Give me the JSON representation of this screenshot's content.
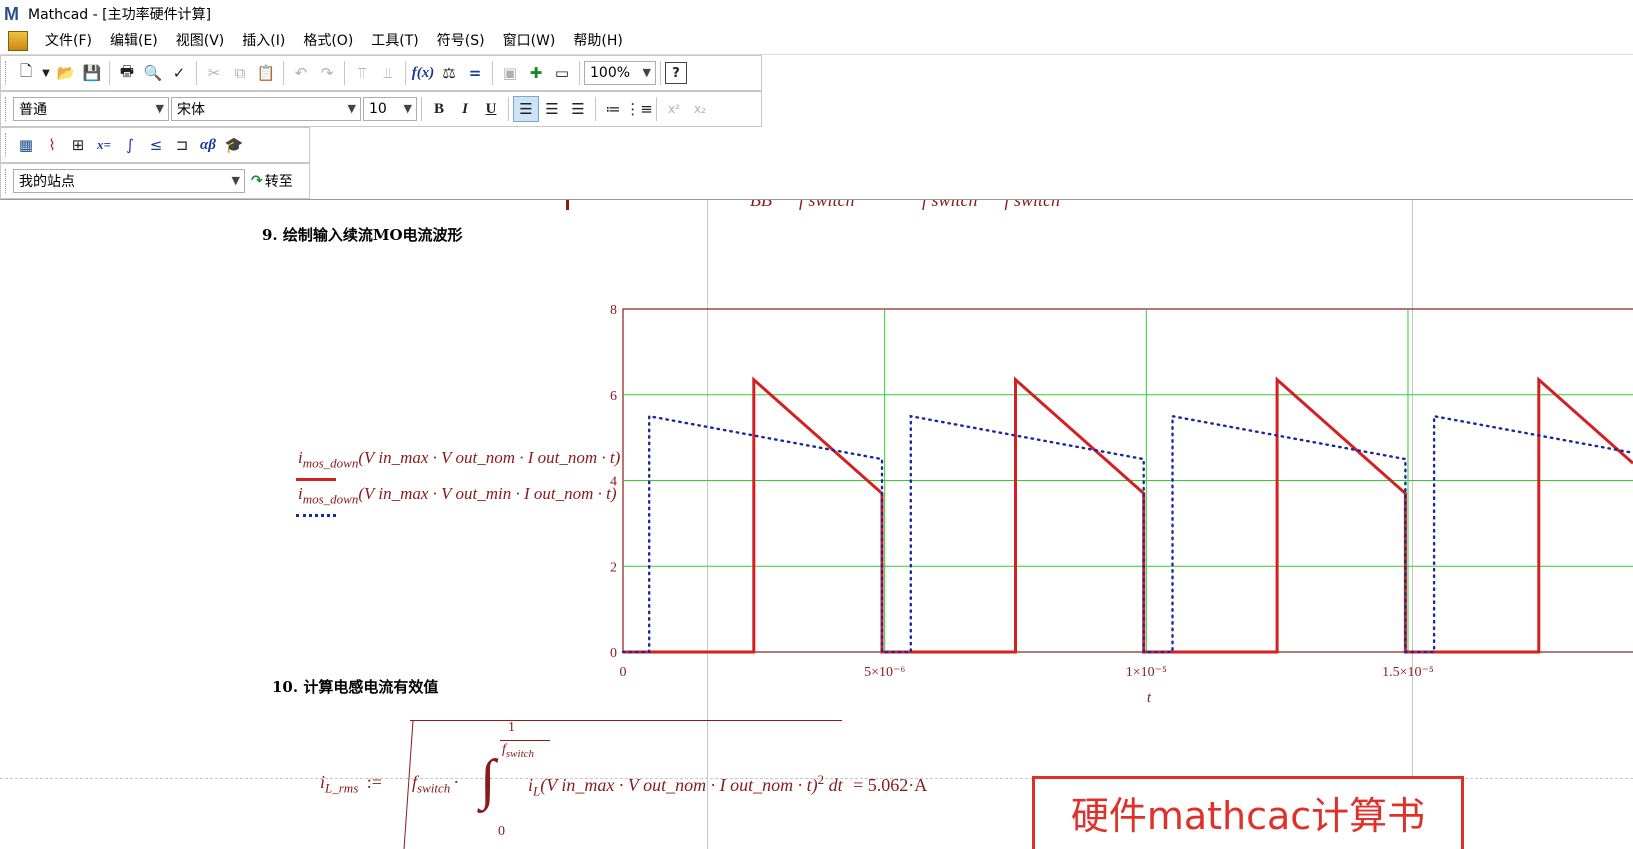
{
  "window": {
    "title": "Mathcad - [主功率硬件计算]",
    "app_icon": "M"
  },
  "menu": [
    "文件(F)",
    "编辑(E)",
    "视图(V)",
    "插入(I)",
    "格式(O)",
    "工具(T)",
    "符号(S)",
    "窗口(W)",
    "帮助(H)"
  ],
  "toolbar": {
    "zoom": "100%",
    "style": "普通",
    "font": "宋体",
    "font_size": "10",
    "bold": "B",
    "italic": "I",
    "underline": "U",
    "math_bar_xeq": "x=",
    "math_bar_greek": "αβ",
    "site": "我的站点",
    "goto": "转至"
  },
  "document": {
    "top_fragment": "BB      f switch               f switch      f switch",
    "section9": "9. 绘制输入续流MO电流波形",
    "section10": "10. 计算电感电流有效值",
    "legend": [
      {
        "fn": "i",
        "sub": "mos_down",
        "args": "(V in_max · V out_nom · I out_nom · t)",
        "style": "solid",
        "color": "#d42020"
      },
      {
        "fn": "i",
        "sub": "mos_down",
        "args": "(V in_max · V out_min · I out_nom · t)",
        "style": "dotted",
        "color": "#1a2a9a"
      }
    ],
    "formula": {
      "lhs": "i",
      "lhs_sub": "L_rms",
      "assign": ":=",
      "f": "f",
      "f_sub": "switch",
      "one": "1",
      "upper_limit_sub": "switch",
      "lower_limit": "0",
      "integrand_fn": "i",
      "integrand_sub": "L",
      "integrand_args": "(V in_max · V out_nom · I out_nom · t)",
      "power": "2",
      "dt": "dt",
      "result": "= 5.062·A"
    },
    "note": "硬件mathcac计算书"
  },
  "chart_data": {
    "type": "line",
    "xlabel": "t",
    "ylabel": "",
    "xlim": [
      0,
      1.93e-05
    ],
    "ylim": [
      0,
      8
    ],
    "y_ticks": [
      "0",
      "2",
      "4",
      "6",
      "8"
    ],
    "x_ticks": [
      {
        "value": 0,
        "label": "0"
      },
      {
        "value": 5e-06,
        "label": "5×10⁻⁶"
      },
      {
        "value": 1e-05,
        "label": "1×10⁻⁵"
      },
      {
        "value": 1.5e-05,
        "label": "1.5×10⁻⁵"
      }
    ],
    "grid": true,
    "period": 5e-06,
    "series": [
      {
        "style": "solid",
        "color": "#d42020",
        "pulse": {
          "on": 2.5e-06,
          "off": 4.95e-06,
          "peak": 6.35,
          "end": 3.7
        }
      },
      {
        "style": "dotted",
        "color": "#1a2a9a",
        "pulse": {
          "on": 5e-07,
          "off": 4.95e-06,
          "peak": 5.5,
          "end": 4.5
        }
      }
    ]
  }
}
